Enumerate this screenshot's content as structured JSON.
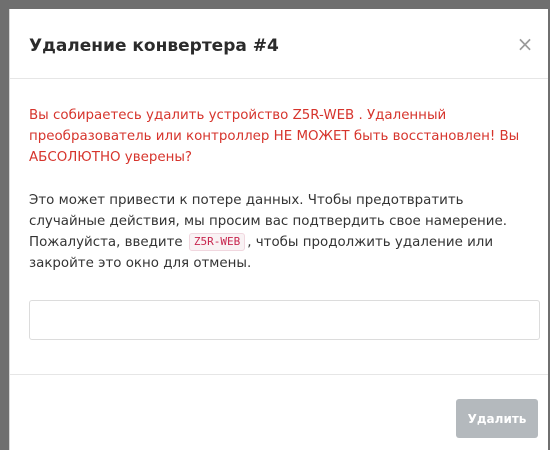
{
  "modal": {
    "title": "Удаление конвертера #4",
    "close_symbol": "×",
    "warning": "Вы собираетесь удалить устройство Z5R-WEB . Удаленный преобразователь или контроллер НЕ МОЖЕТ быть восстановлен! Вы АБСОЛЮТНО уверены?",
    "info_before": "Это может привести к потере данных. Чтобы предотвратить случайные действия, мы просим вас подтвердить свое намерение. Пожалуйста, введите",
    "device_code": "Z5R-WEB",
    "info_after": ", чтобы продолжить удаление или закройте это окно для отмены.",
    "input_value": "",
    "input_placeholder": "",
    "delete_label": "Удалить"
  },
  "colors": {
    "warning": "#d6342c",
    "text": "#333333",
    "button_disabled": "#b4b9bd",
    "code_text": "#c7254e",
    "code_bg": "#f9f2f4"
  },
  "icons": {
    "close": "close-icon"
  }
}
